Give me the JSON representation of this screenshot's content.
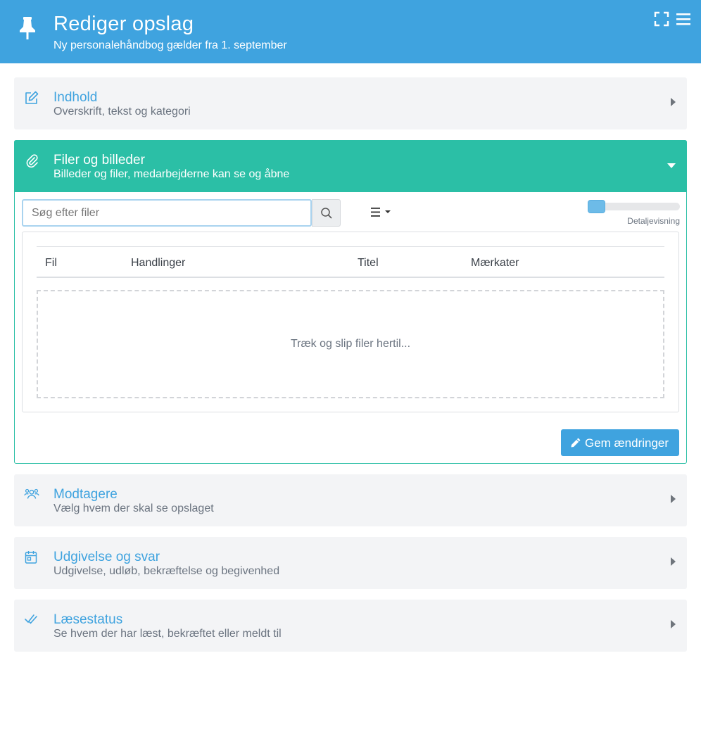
{
  "header": {
    "title": "Rediger opslag",
    "subtitle": "Ny personalehåndbog gælder fra 1. september",
    "bg_color": "#3fa3df"
  },
  "panels": {
    "content": {
      "title": "Indhold",
      "subtitle": "Overskrift, tekst og kategori",
      "icon": "edit-icon"
    },
    "files": {
      "title": "Filer og billeder",
      "subtitle": "Billeder og filer, medarbejderne kan se og åbne",
      "icon": "paperclip-icon",
      "color": "#2bbfa6"
    },
    "recipients": {
      "title": "Modtagere",
      "subtitle": "Vælg hvem der skal se opslaget",
      "icon": "users-icon"
    },
    "publishing": {
      "title": "Udgivelse og svar",
      "subtitle": "Udgivelse, udløb, bekræftelse og begivenhed",
      "icon": "calendar-icon"
    },
    "readstatus": {
      "title": "Læsestatus",
      "subtitle": "Se hvem der har læst, bekræftet eller meldt til",
      "icon": "check-double-icon"
    }
  },
  "files": {
    "search_placeholder": "Søg efter filer",
    "search_value": "",
    "detail_view_label": "Detaljevisning",
    "columns": [
      "Fil",
      "Handlinger",
      "Titel",
      "Mærkater"
    ],
    "dropzone_text": "Træk og slip filer hertil...",
    "save_label": "Gem ændringer"
  }
}
